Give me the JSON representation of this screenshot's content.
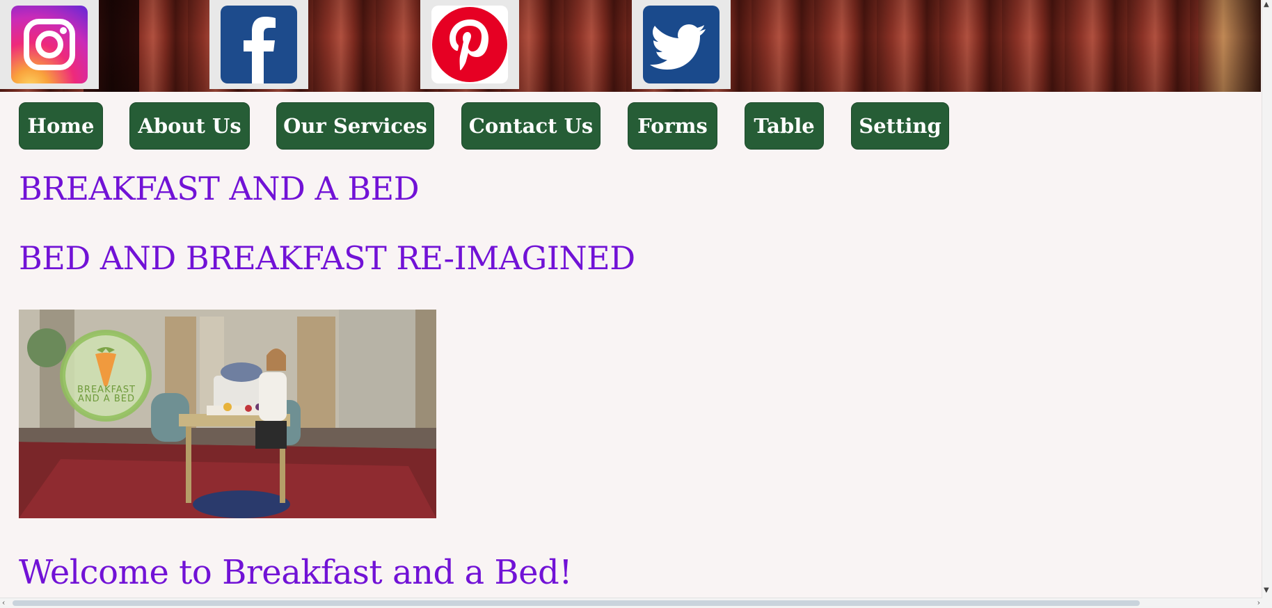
{
  "social": {
    "items": [
      {
        "name": "instagram",
        "icon": "instagram-icon"
      },
      {
        "name": "facebook",
        "icon": "facebook-icon",
        "glyph": "f"
      },
      {
        "name": "pinterest",
        "icon": "pinterest-icon",
        "glyph": "P"
      },
      {
        "name": "twitter",
        "icon": "twitter-icon"
      }
    ]
  },
  "nav": {
    "items": [
      {
        "label": "Home"
      },
      {
        "label": "About Us"
      },
      {
        "label": "Our Services"
      },
      {
        "label": "Contact Us"
      },
      {
        "label": "Forms"
      },
      {
        "label": "Table"
      },
      {
        "label": "Setting"
      }
    ]
  },
  "main": {
    "title": "BREAKFAST AND A BED",
    "subtitle": "BED AND BREAKFAST RE-IMAGINED",
    "hero_logo_line1": "BREAKFAST",
    "hero_logo_line2": "AND A BED",
    "welcome": "Welcome to Breakfast and a Bed!"
  },
  "colors": {
    "heading": "#7112d6",
    "nav_button": "#265d36",
    "nav_text": "#ffffff",
    "page_background": "#f9f4f4"
  }
}
